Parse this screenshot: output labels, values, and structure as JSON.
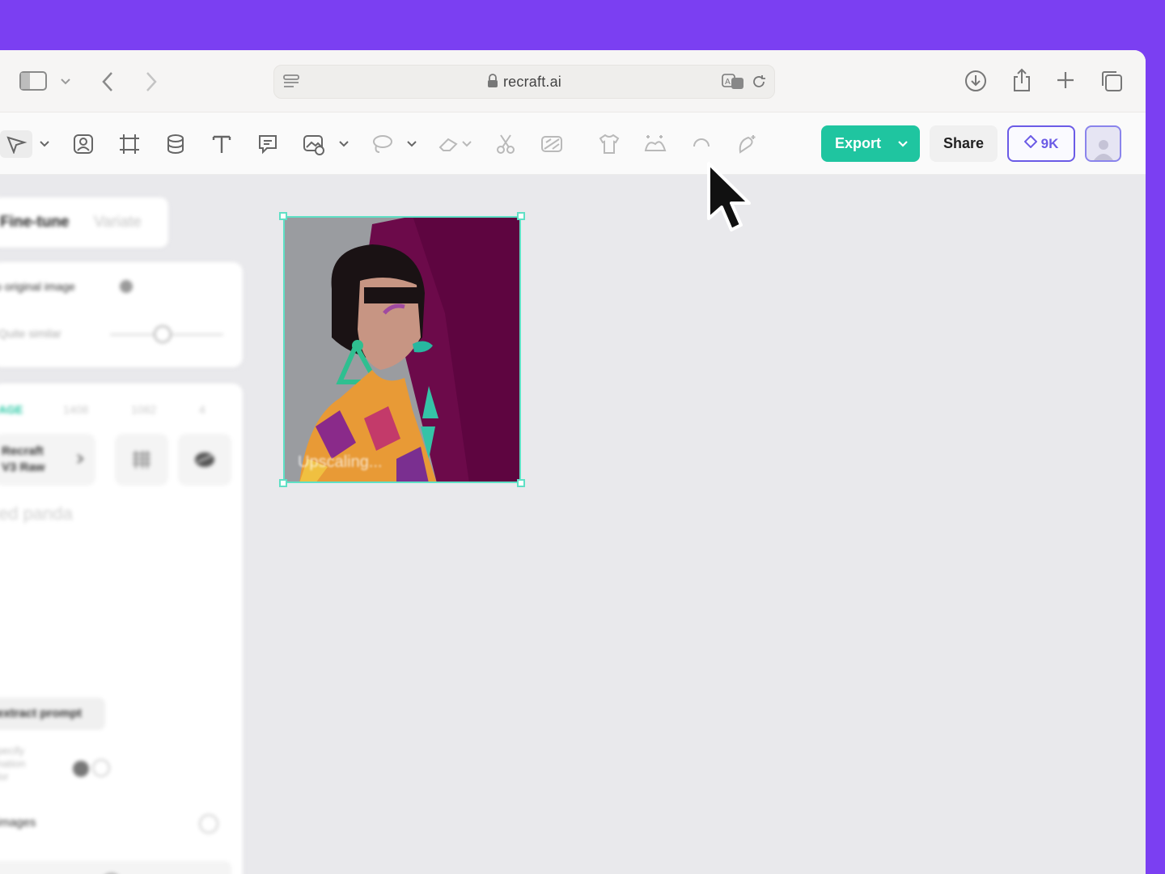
{
  "browser": {
    "url": "recraft.ai"
  },
  "toolbar": {
    "export_label": "Export",
    "share_label": "Share",
    "credits_label": "9K"
  },
  "left_panel": {
    "tab_active": "Fine-tune",
    "tab_inactive": "Variate",
    "original_image_label": "o original image",
    "similarity_label": "Quite similar",
    "style_header": "AGE",
    "size_values": [
      "1408",
      "1082",
      "4"
    ],
    "model_name": "Recraft V3 Raw",
    "prompt_text": "ed panda",
    "extract_prompt_label": "extract prompt",
    "specify_label": "pecify\nnation\nlor",
    "images_label": "images"
  },
  "canvas": {
    "status_text": "Upscaling..."
  },
  "colors": {
    "accent": "#1fc5a0",
    "brand_purple": "#7b3ff2",
    "credits": "#6b5be6",
    "selection": "#5fe0c5"
  }
}
